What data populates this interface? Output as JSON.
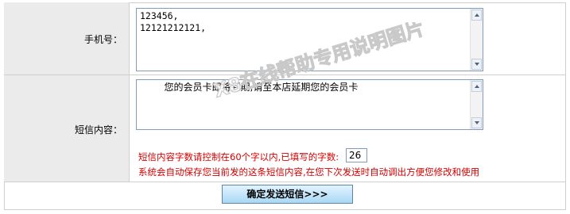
{
  "form": {
    "phone_label": "手机号：",
    "phone_value": "123456,\n12121212121,",
    "sms_label": "短信内容：",
    "sms_value": "        您的会员卡即将到期,请至本店延期您的会员卡",
    "note_line1": "短信内容字数请控制在60个字以内,已填写的字数:",
    "char_count": "26",
    "note_line2": "系统会自动保存您当前发的这条短信内容,在您下次发送时自动调出方便您修改和使用",
    "submit_label": "确定发送短信>>>"
  },
  "watermark": {
    "text": "X8在线帮助专用说明图片"
  },
  "colors": {
    "label_bg": "#ebebeb",
    "note_red": "#d40000",
    "button_top": "#e2f4ff",
    "button_bottom": "#a9d8f5"
  }
}
